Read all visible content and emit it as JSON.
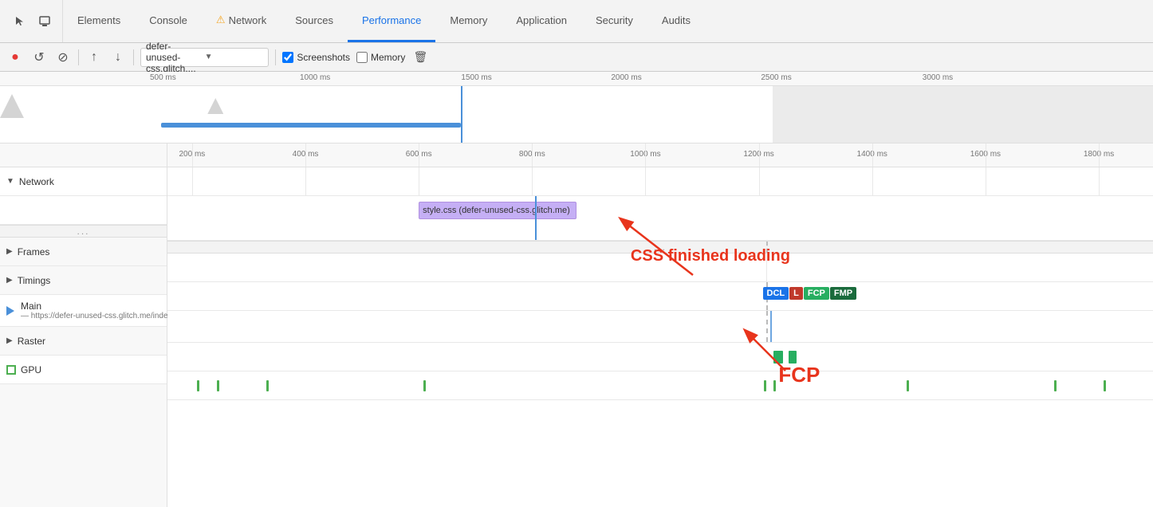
{
  "tabs": {
    "icons": [
      "cursor-icon",
      "box-icon"
    ],
    "items": [
      {
        "label": "Elements",
        "active": false
      },
      {
        "label": "Console",
        "active": false
      },
      {
        "label": "Network",
        "active": false,
        "warning": true
      },
      {
        "label": "Sources",
        "active": false
      },
      {
        "label": "Performance",
        "active": true
      },
      {
        "label": "Memory",
        "active": false
      },
      {
        "label": "Application",
        "active": false
      },
      {
        "label": "Security",
        "active": false
      },
      {
        "label": "Audits",
        "active": false
      }
    ]
  },
  "toolbar": {
    "record_label": "●",
    "reload_label": "↺",
    "clear_label": "⊘",
    "upload_label": "↑",
    "download_label": "↓",
    "profile_select": "defer-unused-css.glitch....",
    "screenshots_label": "Screenshots",
    "memory_label": "Memory",
    "delete_label": "🗑"
  },
  "overview": {
    "ruler_labels": [
      "500 ms",
      "1000 ms",
      "1500 ms",
      "2000 ms",
      "2500 ms",
      "3000 ms"
    ],
    "ruler_positions": [
      13,
      26,
      40,
      53,
      66,
      80
    ]
  },
  "detail": {
    "ruler_labels": [
      "200 ms",
      "400 ms",
      "600 ms",
      "800 ms",
      "1000 ms",
      "1200 ms",
      "1400 ms",
      "1600 ms",
      "1800 ms"
    ],
    "rows": [
      {
        "label": "Network",
        "type": "section",
        "expandable": true
      },
      {
        "label": "style.css (defer-unused-css.glitch.me)",
        "type": "net-item"
      },
      {
        "label": "Frames",
        "type": "expandable"
      },
      {
        "label": "Timings",
        "type": "expandable"
      },
      {
        "label": "Main — https://defer-unused-css.glitch.me/index-unoptimized.html",
        "type": "main"
      },
      {
        "label": "Raster",
        "type": "expandable"
      },
      {
        "label": "GPU",
        "type": "gpu"
      }
    ],
    "badges": [
      {
        "label": "DCL",
        "type": "dcl"
      },
      {
        "label": "L",
        "type": "l"
      },
      {
        "label": "FCP",
        "type": "fcp"
      },
      {
        "label": "FMP",
        "type": "fmp"
      }
    ]
  },
  "annotations": {
    "css_label": "CSS finished loading",
    "fcp_label": "FCP"
  }
}
